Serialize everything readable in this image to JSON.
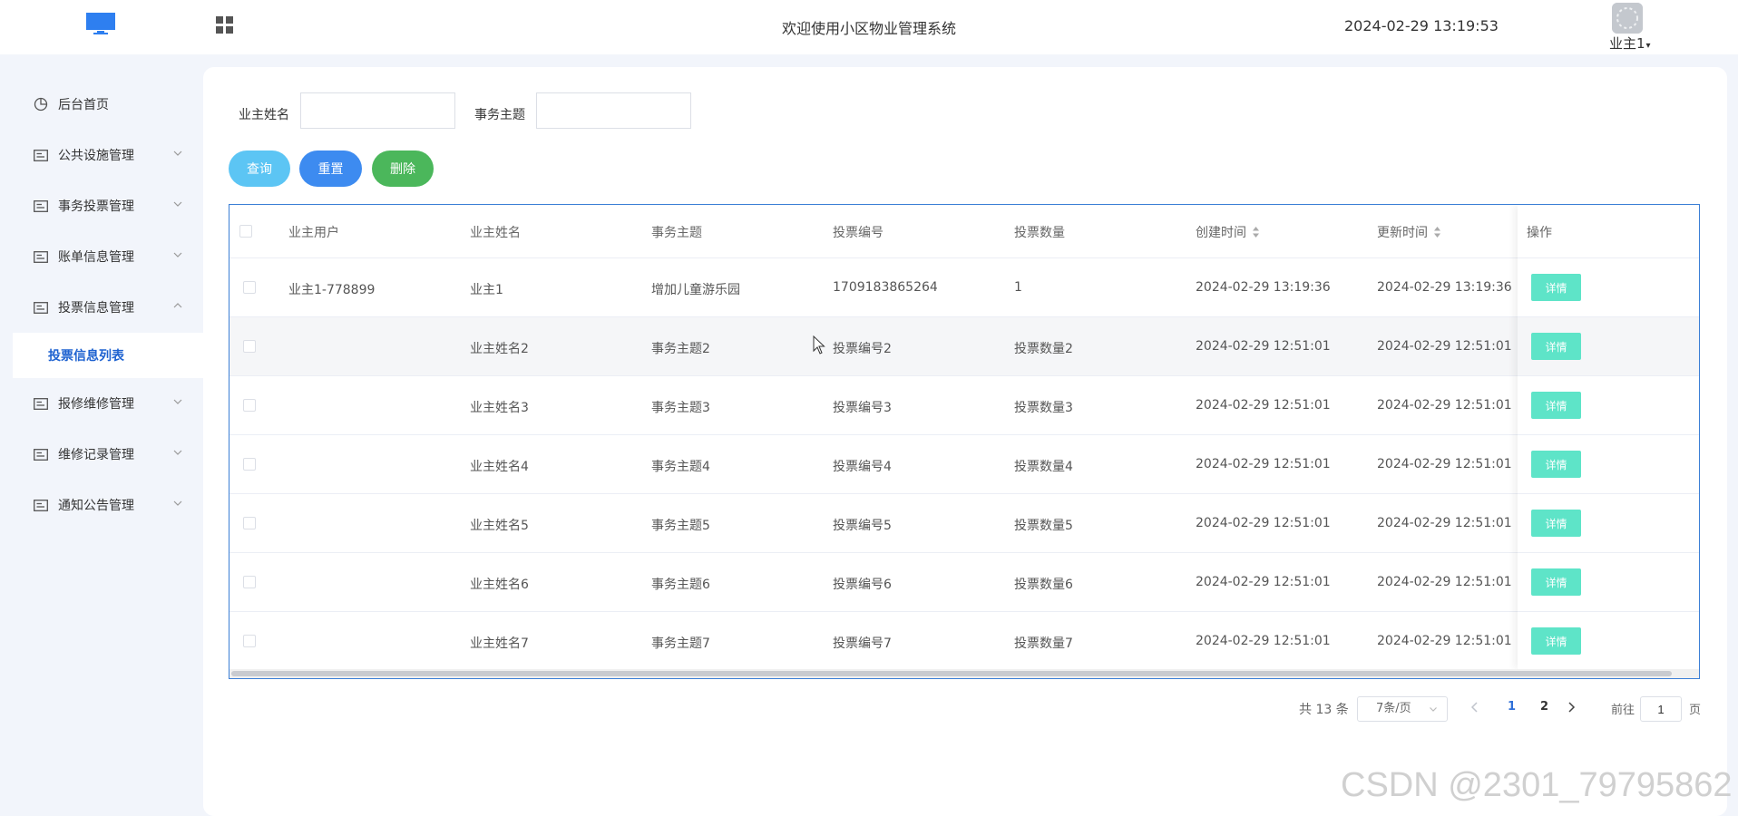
{
  "header": {
    "title": "欢迎使用小区物业管理系统",
    "datetime": "2024-02-29 13:19:53",
    "user": "业主1",
    "colors": {
      "logo": "#2e7ff0",
      "grid": "#555555"
    }
  },
  "sidebar": {
    "items": [
      {
        "label": "后台首页",
        "icon": "clock-icon"
      },
      {
        "label": "公共设施管理",
        "icon": "card-icon"
      },
      {
        "label": "事务投票管理",
        "icon": "card-icon"
      },
      {
        "label": "账单信息管理",
        "icon": "card-icon"
      },
      {
        "label": "投票信息管理",
        "icon": "card-icon",
        "expanded": true
      },
      {
        "label": "报修维修管理",
        "icon": "card-icon"
      },
      {
        "label": "维修记录管理",
        "icon": "card-icon"
      },
      {
        "label": "通知公告管理",
        "icon": "card-icon"
      }
    ],
    "active_submenu": "投票信息列表"
  },
  "search": {
    "owner_name_label": "业主姓名",
    "owner_name_value": "",
    "topic_label": "事务主题",
    "topic_value": ""
  },
  "buttons": {
    "query": "查询",
    "reset": "重置",
    "delete": "删除"
  },
  "table": {
    "headers": [
      "业主用户",
      "业主姓名",
      "事务主题",
      "投票编号",
      "投票数量",
      "创建时间",
      "更新时间",
      "操作"
    ],
    "detail_label": "详情",
    "rows": [
      [
        "业主1-778899",
        "业主1",
        "增加儿童游乐园",
        "1709183865264",
        "1",
        "2024-02-29 13:19:36",
        "2024-02-29 13:19:36"
      ],
      [
        "",
        "业主姓名2",
        "事务主题2",
        "投票编号2",
        "投票数量2",
        "2024-02-29 12:51:01",
        "2024-02-29 12:51:01"
      ],
      [
        "",
        "业主姓名3",
        "事务主题3",
        "投票编号3",
        "投票数量3",
        "2024-02-29 12:51:01",
        "2024-02-29 12:51:01"
      ],
      [
        "",
        "业主姓名4",
        "事务主题4",
        "投票编号4",
        "投票数量4",
        "2024-02-29 12:51:01",
        "2024-02-29 12:51:01"
      ],
      [
        "",
        "业主姓名5",
        "事务主题5",
        "投票编号5",
        "投票数量5",
        "2024-02-29 12:51:01",
        "2024-02-29 12:51:01"
      ],
      [
        "",
        "业主姓名6",
        "事务主题6",
        "投票编号6",
        "投票数量6",
        "2024-02-29 12:51:01",
        "2024-02-29 12:51:01"
      ],
      [
        "",
        "业主姓名7",
        "事务主题7",
        "投票编号7",
        "投票数量7",
        "2024-02-29 12:51:01",
        "2024-02-29 12:51:01"
      ]
    ]
  },
  "pagination": {
    "total": "共 13 条",
    "page_size": "7条/页",
    "pages": [
      "1",
      "2"
    ],
    "current_page": "1",
    "goto_label": "前往",
    "goto_value": "1",
    "page_suffix": "页",
    "colors": {
      "active": "#2f6fd8",
      "inactive": "#333333"
    }
  },
  "watermark": "CSDN @2301_79795862"
}
